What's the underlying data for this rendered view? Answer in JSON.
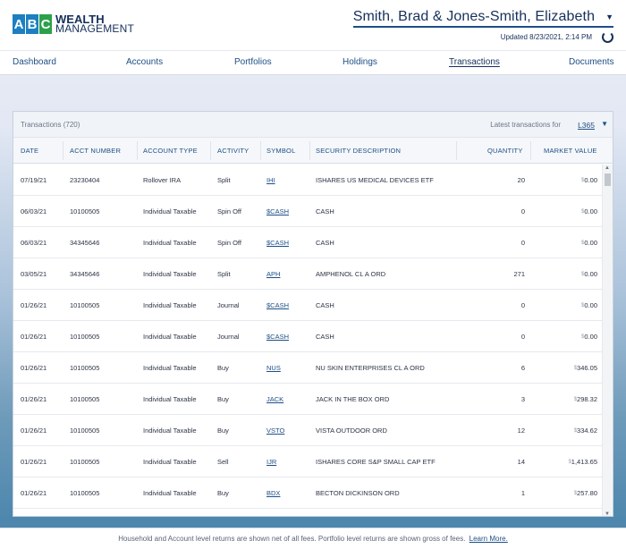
{
  "header": {
    "logo_letters": [
      "A",
      "B",
      "C"
    ],
    "logo_line1": "WEALTH",
    "logo_line2": "MANAGEMENT",
    "client_name": "Smith, Brad & Jones-Smith, Elizabeth",
    "updated": "Updated 8/23/2021, 2:14 PM"
  },
  "nav": [
    {
      "label": "Dashboard"
    },
    {
      "label": "Accounts"
    },
    {
      "label": "Portfolios"
    },
    {
      "label": "Holdings"
    },
    {
      "label": "Transactions"
    },
    {
      "label": "Documents"
    }
  ],
  "panel": {
    "title": "Transactions (720)",
    "latest_label": "Latest transactions for",
    "latest_value": "L365"
  },
  "columns": [
    "DATE",
    "ACCT NUMBER",
    "ACCOUNT TYPE",
    "ACTIVITY",
    "SYMBOL",
    "SECURITY DESCRIPTION",
    "QUANTITY",
    "MARKET VALUE"
  ],
  "rows": [
    {
      "date": "07/19/21",
      "acct": "23230404",
      "type": "Rollover IRA",
      "activity": "Split",
      "symbol": "IHI",
      "desc": "ISHARES US MEDICAL DEVICES ETF",
      "qty": "20",
      "value": "0.00"
    },
    {
      "date": "06/03/21",
      "acct": "10100505",
      "type": "Individual Taxable",
      "activity": "Spin Off",
      "symbol": "$CASH",
      "desc": "CASH",
      "qty": "0",
      "value": "0.00"
    },
    {
      "date": "06/03/21",
      "acct": "34345646",
      "type": "Individual Taxable",
      "activity": "Spin Off",
      "symbol": "$CASH",
      "desc": "CASH",
      "qty": "0",
      "value": "0.00"
    },
    {
      "date": "03/05/21",
      "acct": "34345646",
      "type": "Individual Taxable",
      "activity": "Split",
      "symbol": "APH",
      "desc": "AMPHENOL CL A ORD",
      "qty": "271",
      "value": "0.00"
    },
    {
      "date": "01/26/21",
      "acct": "10100505",
      "type": "Individual Taxable",
      "activity": "Journal",
      "symbol": "$CASH",
      "desc": "CASH",
      "qty": "0",
      "value": "0.00"
    },
    {
      "date": "01/26/21",
      "acct": "10100505",
      "type": "Individual Taxable",
      "activity": "Journal",
      "symbol": "$CASH",
      "desc": "CASH",
      "qty": "0",
      "value": "0.00"
    },
    {
      "date": "01/26/21",
      "acct": "10100505",
      "type": "Individual Taxable",
      "activity": "Buy",
      "symbol": "NUS",
      "desc": "NU SKIN ENTERPRISES CL A ORD",
      "qty": "6",
      "value": "346.05"
    },
    {
      "date": "01/26/21",
      "acct": "10100505",
      "type": "Individual Taxable",
      "activity": "Buy",
      "symbol": "JACK",
      "desc": "JACK IN THE BOX ORD",
      "qty": "3",
      "value": "298.32"
    },
    {
      "date": "01/26/21",
      "acct": "10100505",
      "type": "Individual Taxable",
      "activity": "Buy",
      "symbol": "VSTO",
      "desc": "VISTA OUTDOOR ORD",
      "qty": "12",
      "value": "334.62"
    },
    {
      "date": "01/26/21",
      "acct": "10100505",
      "type": "Individual Taxable",
      "activity": "Sell",
      "symbol": "IJR",
      "desc": "ISHARES CORE S&P SMALL CAP ETF",
      "qty": "14",
      "value": "1,413.65"
    },
    {
      "date": "01/26/21",
      "acct": "10100505",
      "type": "Individual Taxable",
      "activity": "Buy",
      "symbol": "BDX",
      "desc": "BECTON DICKINSON ORD",
      "qty": "1",
      "value": "257.80"
    }
  ],
  "currency_symbol": "$",
  "footer": {
    "text": "Household and Account level returns are shown net of all fees. Portfolio level returns are shown gross of fees.",
    "link": "Learn More."
  },
  "colors": {
    "brand_navy": "#16305a",
    "link_blue": "#1d4f86",
    "logo_blue": "#1c7fc2",
    "logo_green": "#2da14a"
  },
  "icons": [
    "refresh-icon",
    "chevron-down-icon",
    "scroll-up-icon",
    "scroll-down-icon"
  ]
}
